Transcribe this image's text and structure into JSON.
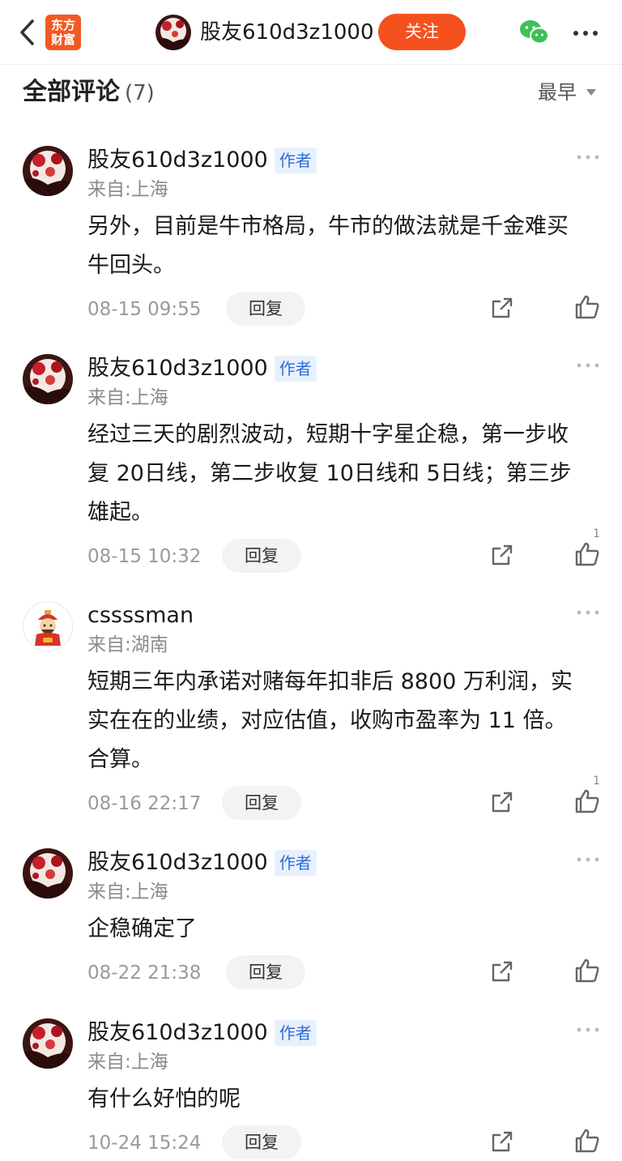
{
  "header": {
    "brand": [
      "东方",
      "财富"
    ],
    "username": "股友610d3z1000",
    "follow_label": "关注"
  },
  "section": {
    "title": "全部评论",
    "count": "(7)",
    "sort_label": "最早"
  },
  "colors": {
    "accent": "#f4511e",
    "brand": "#f15a22",
    "badge_bg": "#e8f0fc",
    "badge_text": "#2f6fd6"
  },
  "comments": [
    {
      "user": "股友610d3z1000",
      "badge": "作者",
      "location": "来自:上海",
      "text": "另外，目前是牛市格局，牛市的做法就是千金难买牛回头。",
      "time": "08-15 09:55",
      "reply_label": "回复",
      "likes": ""
    },
    {
      "user": "股友610d3z1000",
      "badge": "作者",
      "location": "来自:上海",
      "text": "经过三天的剧烈波动，短期十字星企稳，第一步收复 20日线，第二步收复 10日线和 5日线；第三步雄起。",
      "time": "08-15 10:32",
      "reply_label": "回复",
      "likes": "1"
    },
    {
      "user": "cssssman",
      "badge": "",
      "location": "来自:湖南",
      "text": "短期三年内承诺对赌每年扣非后 8800 万利润，实实在在的业绩，对应估值，收购市盈率为 11 倍。合算。",
      "time": "08-16 22:17",
      "reply_label": "回复",
      "likes": "1"
    },
    {
      "user": "股友610d3z1000",
      "badge": "作者",
      "location": "来自:上海",
      "text": "企稳确定了",
      "time": "08-22 21:38",
      "reply_label": "回复",
      "likes": ""
    },
    {
      "user": "股友610d3z1000",
      "badge": "作者",
      "location": "来自:上海",
      "text": "有什么好怕的呢",
      "time": "10-24 15:24",
      "reply_label": "回复",
      "likes": ""
    }
  ]
}
